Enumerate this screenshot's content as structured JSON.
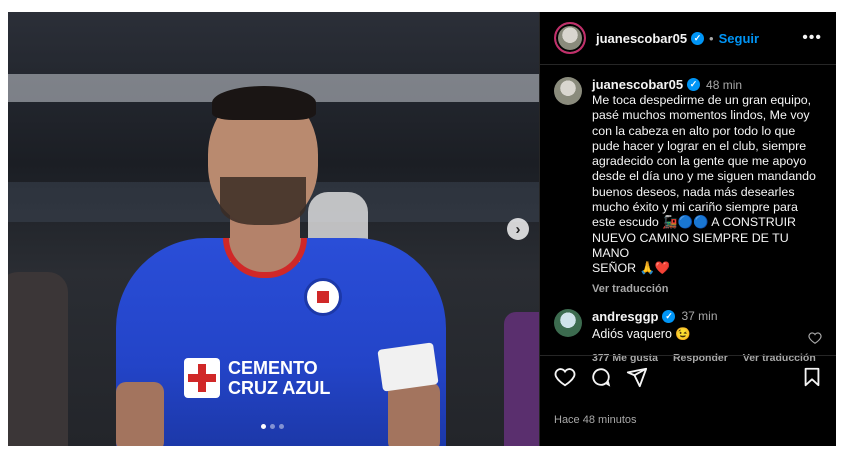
{
  "post": {
    "username": "juanescobar05",
    "follow_label": "Seguir",
    "more_label": "•••",
    "separator": "•"
  },
  "caption": {
    "username": "juanescobar05",
    "time": "48 min",
    "text": "Me toca despedirme de un gran equipo,\npasé muchos momentos lindos, Me voy\ncon la cabeza en alto por todo lo que\npude hacer y lograr en el club, siempre\nagradecido con la gente que me apoyo\ndesde el día uno y me siguen mandando\nbuenos deseos, nada más desearles\nmucho éxito y mi cariño siempre para\neste escudo 🚂🔵🔵 A CONSTRUIR\nNUEVO CAMINO SIEMPRE DE TU MANO\nSEÑOR 🙏❤️",
    "see_translation": "Ver traducción"
  },
  "comment": {
    "username": "andresggp",
    "time": "37 min",
    "text": "Adiós vaquero 😉",
    "likes": "377 Me gusta",
    "reply": "Responder",
    "see_translation": "Ver traducción"
  },
  "footer": {
    "posted": "Hace 48 minutos"
  },
  "photo": {
    "sponsor_line1": "CEMENTO",
    "sponsor_line2": "CRUZ AZUL",
    "next_icon": "chevron-right-icon",
    "carousel_count": 3,
    "carousel_active": 1
  },
  "colors": {
    "accent": "#0095f6",
    "background": "#000000",
    "jersey": "#2344c8"
  }
}
